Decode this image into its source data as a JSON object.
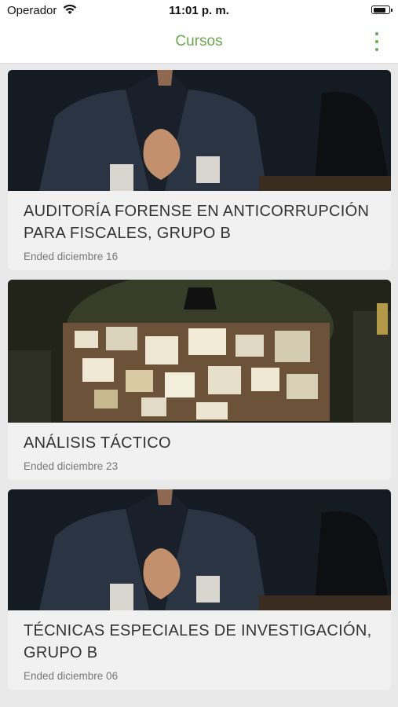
{
  "status": {
    "carrier": "Operador",
    "time": "11:01 p. m."
  },
  "header": {
    "title": "Cursos",
    "menu_icon": "more-vert-icon"
  },
  "courses": [
    {
      "title": "AUDITORÍA FORENSE EN ANTICORRUPCIÓN PARA FISCALES, GRUPO B",
      "date": "Ended diciembre 16",
      "image": "man-in-suit-photo"
    },
    {
      "title": "ANÁLISIS TÁCTICO",
      "date": "Ended diciembre 23",
      "image": "evidence-board-photo"
    },
    {
      "title": "TÉCNICAS ESPECIALES DE INVESTIGACIÓN, GRUPO B",
      "date": "Ended diciembre 06",
      "image": "man-in-suit-photo"
    }
  ],
  "colors": {
    "accent": "#6aa84f"
  }
}
